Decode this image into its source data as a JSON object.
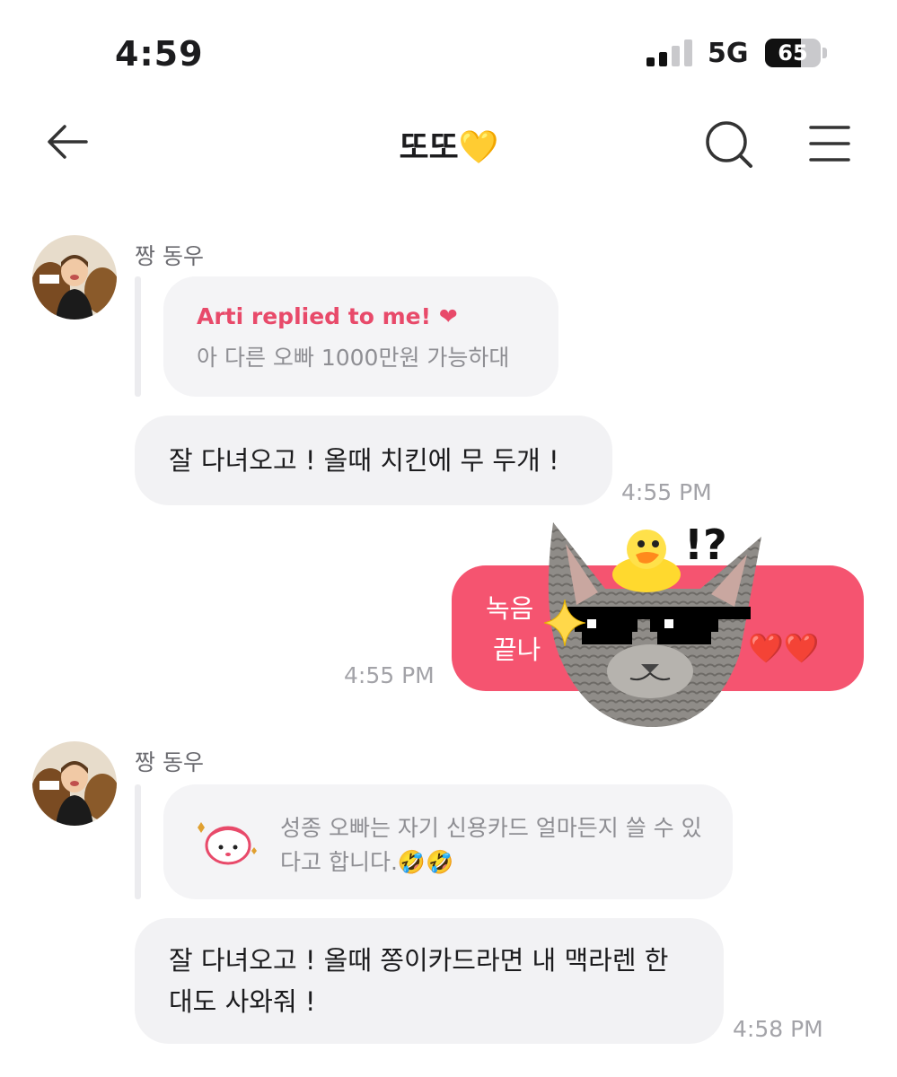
{
  "status": {
    "time": "4:59",
    "network": "5G",
    "battery": "65",
    "battery_level": 0.65
  },
  "header": {
    "title": "또또💛"
  },
  "messages": [
    {
      "sender": "짱 동우",
      "quote": {
        "label": "Arti replied to me! ❤",
        "text": "아 다른 오빠 1000만원 가능하대"
      },
      "body": "잘 다녀오고 ! 올때 치킨에 무 두개 !",
      "time": "4:55 PM"
    },
    {
      "mine": true,
      "body_line1": "녹음 ",
      "body_line2": "끝나",
      "hearts": "❤️❤️",
      "sticker_mark": "!?",
      "time": "4:55 PM"
    },
    {
      "sender": "짱 동우",
      "quote": {
        "text": "성종 오빠는 자기 신용카드 얼마든지 쓸 수 있다고 합니다.🤣🤣"
      },
      "body": "잘 다녀오고 ! 올때 쫑이카드라면 내 맥라렌 한 대도 사와줘 !",
      "time": "4:58 PM"
    }
  ],
  "icons": [
    "back-arrow-icon",
    "search-icon",
    "menu-icon",
    "signal-icon",
    "battery-icon",
    "cat-sticker",
    "duck-sticker",
    "sparkle-icon",
    "character-emoticon"
  ],
  "colors": {
    "accent": "#f55470",
    "reply_label": "#e84a6a",
    "bubble": "#f2f2f4"
  }
}
